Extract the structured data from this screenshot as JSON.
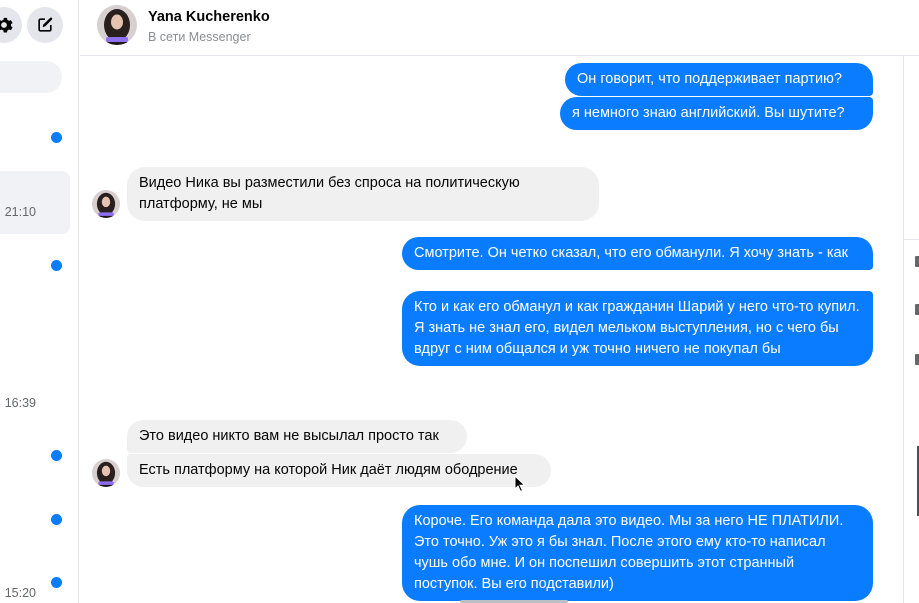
{
  "sidebar": {
    "settings_icon": "gear-icon",
    "compose_icon": "compose-icon",
    "times": [
      "21:10",
      "16:39",
      "15:20"
    ]
  },
  "header": {
    "name": "Yana Kucherenko",
    "status": "В сети Messenger"
  },
  "messages": [
    {
      "side": "out",
      "text": "Он говорит, что поддерживает партию?"
    },
    {
      "side": "out",
      "text": "я немного знаю английский. Вы шутите?"
    },
    {
      "side": "in",
      "text": "Видео Ника вы разместили без спроса на политическую платформу, не мы"
    },
    {
      "side": "out",
      "text": "Смотрите. Он четко сказал, что его обманули. Я хочу знать - как"
    },
    {
      "side": "out",
      "text": "Кто и как его обманул и как гражданин Шарий у него что-то купил. Я знать не знал его, видел мельком выступления, но с чего бы вдруг с ним общался и уж точно ничего не покупал бы"
    },
    {
      "side": "in",
      "text": "Это видео никто вам не высылал просто так"
    },
    {
      "side": "in",
      "text": "Есть платформу на которой Ник даёт людям ободрение"
    },
    {
      "side": "out",
      "text": "Короче. Его команда дала это видео. Мы за него НЕ ПЛАТИЛИ. Это точно. Уж это я бы знал. После этого ему кто-то написал чушь обо мне. И он поспешил совершить этот странный поступок. Вы его подставили)"
    }
  ],
  "colors": {
    "outgoing": "#0a7cff",
    "incoming": "#f0f0f0",
    "unread_dot": "#0a7cff"
  }
}
